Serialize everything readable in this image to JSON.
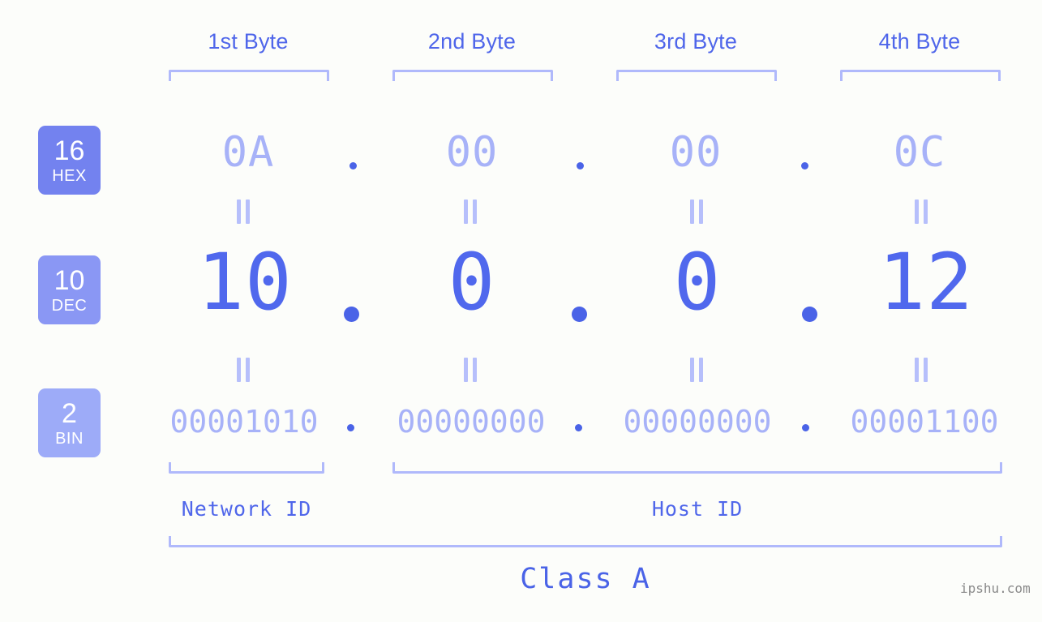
{
  "colors": {
    "background": "#fcfdfa",
    "light_blue": "#a7b2f8",
    "bracket_blue": "#b0b9fb",
    "strong_blue": "#4a63e7",
    "header_blue": "#4f66ea",
    "badge_hex": "#7382ef",
    "badge_dec": "#8a97f4",
    "badge_bin": "#9dabf8",
    "watermark_gray": "#8a8a8a"
  },
  "headers": [
    {
      "label": "1st Byte"
    },
    {
      "label": "2nd Byte"
    },
    {
      "label": "3rd Byte"
    },
    {
      "label": "4th Byte"
    }
  ],
  "rows": {
    "hex": {
      "badge_num": "16",
      "badge_unit": "HEX",
      "values": [
        "0A",
        "00",
        "00",
        "0C"
      ],
      "separator": "."
    },
    "dec": {
      "badge_num": "10",
      "badge_unit": "DEC",
      "values": [
        "10",
        "0",
        "0",
        "12"
      ],
      "separator": "."
    },
    "bin": {
      "badge_num": "2",
      "badge_unit": "BIN",
      "values": [
        "00001010",
        "00000000",
        "00000000",
        "00001100"
      ],
      "separator": "."
    }
  },
  "equality_symbol": "=",
  "segments": {
    "network_id": "Network ID",
    "host_id": "Host ID",
    "class": "Class A"
  },
  "watermark": "ipshu.com"
}
